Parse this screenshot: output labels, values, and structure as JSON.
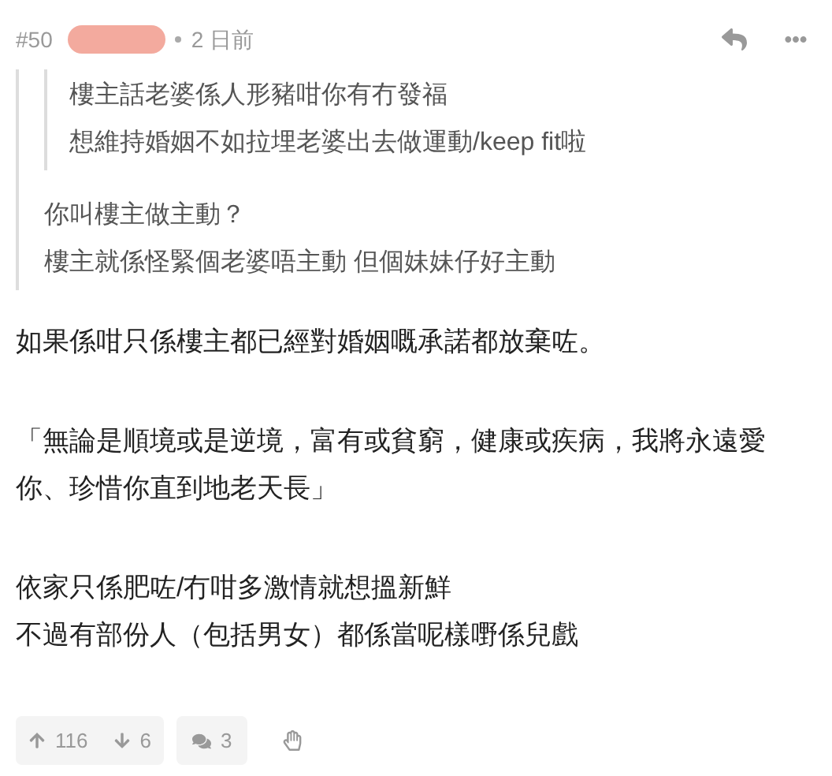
{
  "header": {
    "floor": "#50",
    "redacted": true,
    "time": "2 日前"
  },
  "quote": {
    "inner_lines": [
      "樓主話老婆係人形豬咁你有冇發福",
      "想維持婚姻不如拉埋老婆出去做運動/keep fit啦"
    ],
    "lines": [
      "你叫樓主做主動？",
      "樓主就係怪緊個老婆唔主動 但個妹妹仔好主動"
    ]
  },
  "paragraphs": [
    [
      "如果係咁只係樓主都已經對婚姻嘅承諾都放棄咗。"
    ],
    [
      "「無論是順境或是逆境，富有或貧窮，健康或疾病，我將永遠愛你、珍惜你直到地老天長」"
    ],
    [
      "依家只係肥咗/冇咁多激情就想搵新鮮",
      "不過有部份人（包括男女）都係當呢樣嘢係兒戲"
    ]
  ],
  "actions": {
    "upvotes": "116",
    "downvotes": "6",
    "replies": "3"
  }
}
